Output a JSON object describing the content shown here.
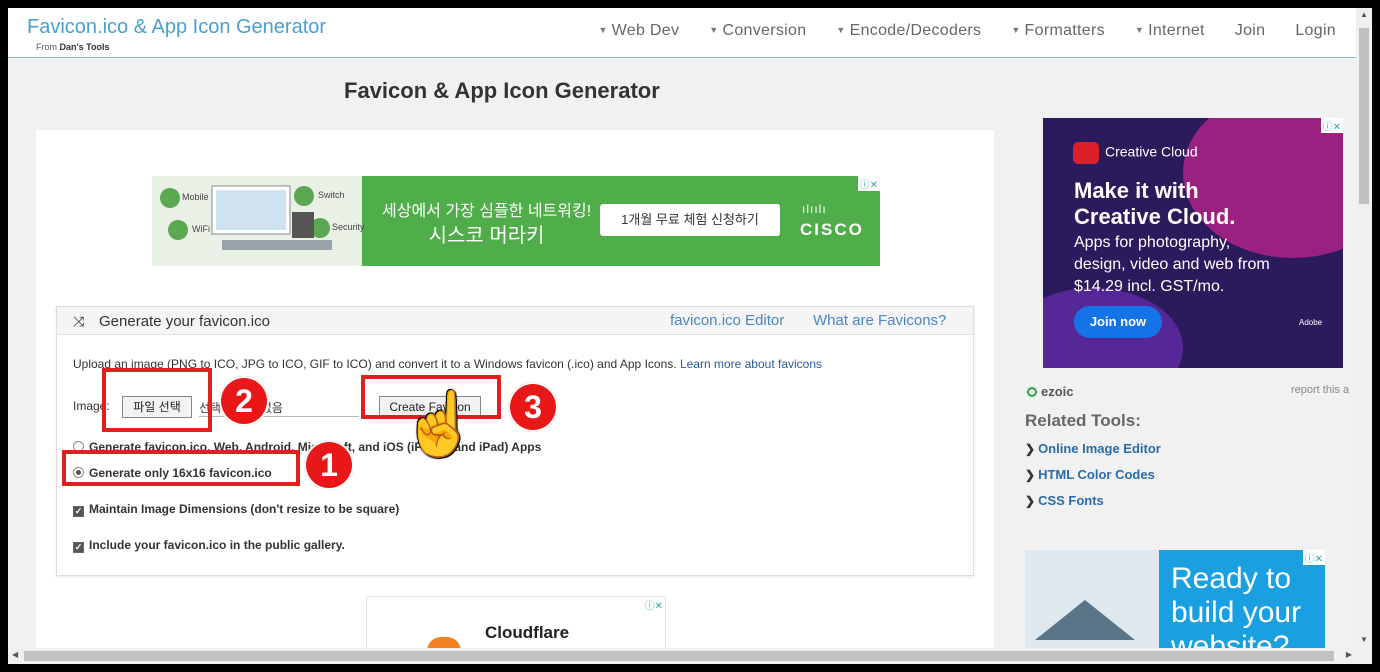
{
  "header": {
    "brand": "Favicon.ico & App Icon Generator",
    "brand_sub_prefix": "From",
    "brand_sub_name": "Dan's Tools",
    "nav": [
      "Web Dev",
      "Conversion",
      "Encode/Decoders",
      "Formatters",
      "Internet"
    ],
    "join": "Join",
    "login": "Login"
  },
  "page": {
    "title": "Favicon & App Icon Generator"
  },
  "ad_top": {
    "categories": [
      "Mobile",
      "Switch",
      "WiFi",
      "Security"
    ],
    "line1": "세상에서 가장 심플한 네트워킹!",
    "line2": "시스코 머라키",
    "cta": "1개월 무료 체험 신청하기",
    "logo": "CISCO"
  },
  "generator": {
    "title": "Generate your favicon.ico",
    "link_editor": "favicon.ico Editor",
    "link_what": "What are Favicons?",
    "desc": "Upload an image (PNG to ICO, JPG to ICO, GIF to ICO) and convert it to a Windows favicon (.ico) and App Icons.",
    "desc_link": "Learn more about favicons",
    "image_label": "Image:",
    "file_button": "파일 선택",
    "file_status": "선택된 파일 없음",
    "create_button": "Create Favicon",
    "option_all": "Generate favicon.ico, Web, Android, Microsoft, and iOS (iPhone and iPad) Apps",
    "option_16": "Generate only 16x16 favicon.ico",
    "option_maintain": "Maintain Image Dimensions (don't resize to be square)",
    "option_gallery": "Include your favicon.ico in the public gallery."
  },
  "ad_bottom": {
    "brand": "Cloudflare"
  },
  "sidebar": {
    "ad_cc": {
      "brand": "Creative Cloud",
      "headline1": "Make it with",
      "headline2": "Creative Cloud.",
      "body1": "Apps for photography,",
      "body2": "design, video and web from",
      "body3": "$14.29 incl. GST/mo.",
      "cta": "Join now",
      "adobe": "Adobe"
    },
    "ezoic": "ezoic",
    "report": "report this a",
    "related_title": "Related Tools:",
    "related": [
      "Online Image Editor",
      "HTML Color Codes",
      "CSS Fonts"
    ],
    "ad_build": {
      "line1": "Ready to",
      "line2": "build your",
      "line3": "website?"
    }
  },
  "annotations": [
    "1",
    "2",
    "3"
  ],
  "colors": {
    "brand": "#4a9fcf",
    "link": "#2a6ca8",
    "annotation": "#e02020"
  }
}
